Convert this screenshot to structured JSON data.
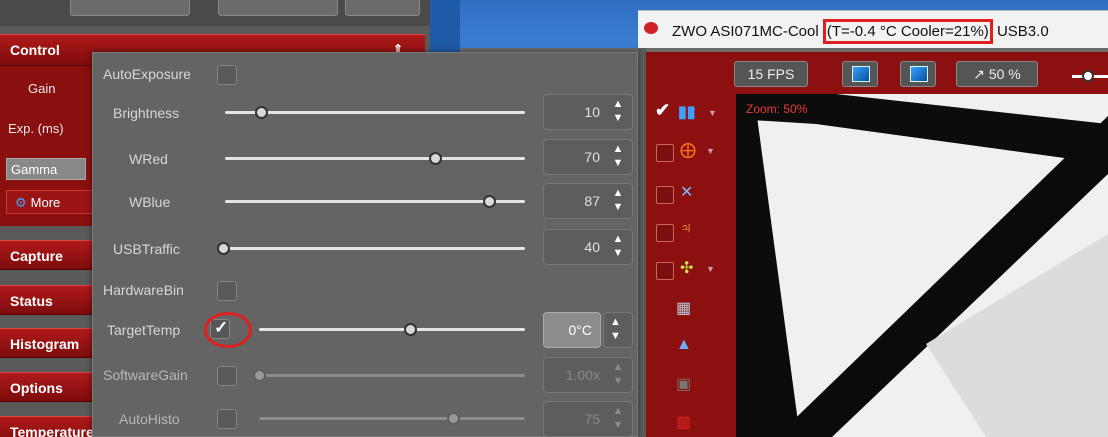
{
  "dock": {
    "groups": {
      "control": "Control",
      "capture": "Capture",
      "status": "Status",
      "histogram": "Histogram",
      "options": "Options",
      "temperature": "Temperature"
    },
    "control_items": {
      "gain": "Gain",
      "exposure": "Exp. (ms)",
      "gamma": "Gamma",
      "more": "More"
    }
  },
  "popup": {
    "auto_exposure_label": "AutoExposure",
    "rows": [
      {
        "label": "Brightness",
        "value": "10",
        "level": 0.13
      },
      {
        "label": "WRed",
        "value": "70",
        "level": 0.7
      },
      {
        "label": "WBlue",
        "value": "87",
        "level": 0.87
      },
      {
        "label": "USBTraffic",
        "value": "40",
        "level": 0.0
      },
      {
        "label": "HardwareBin"
      },
      {
        "label": "TargetTemp",
        "value": "0°C",
        "checked": true,
        "level": 0.62
      },
      {
        "label": "SoftwareGain",
        "value": "1.00x",
        "checked": false,
        "level": 0.0
      },
      {
        "label": "AutoHisto",
        "value": "75",
        "checked": false,
        "level": 0.75
      }
    ]
  },
  "window": {
    "title_prefix": "ZWO ASI071MC-Cool",
    "title_status": "(T=-0.4 °C  Cooler=21%)",
    "title_suffix": "USB3.0"
  },
  "toolbar": {
    "fps": "15 FPS",
    "zoom": "50 %"
  },
  "preview": {
    "zoom_label": "Zoom: 50%"
  },
  "colors": {
    "accent_red": "#8c1010",
    "highlight_red": "#e02020"
  }
}
